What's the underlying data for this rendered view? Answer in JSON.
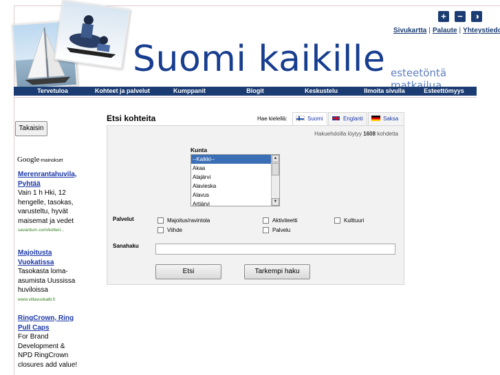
{
  "header": {
    "title": "Suomi kaikille",
    "tagline": "esteetöntä matkailua",
    "icon_buttons": [
      {
        "icon": "plus-icon",
        "glyph": "+"
      },
      {
        "icon": "minus-icon",
        "glyph": "−"
      },
      {
        "icon": "contrast-icon",
        "glyph": "◑"
      }
    ],
    "top_links": [
      "Sivukartta",
      "Palaute",
      "Yhteystiedot"
    ]
  },
  "nav": {
    "items": [
      "Tervetuloa",
      "Kohteet ja palvelut",
      "Kumppanit",
      "Blogit",
      "Keskustelu",
      "Ilmoita sivulla",
      "Esteettömyys"
    ]
  },
  "sidebar": {
    "back_label": "Takaisin",
    "ads_brand": "Google",
    "ads_label": "-mainokset",
    "ads": [
      {
        "title": "Merenrantahuvila, Pyhtää",
        "body": "Vain 1 h Hki, 12 hengelle, tasokas, varusteltu, hyvät maisemat ja vedet",
        "url": "savanturn.com/kotteri..."
      },
      {
        "title": "Majoitusta Vuokatissa",
        "body": "Tasokasta loma-asumista Uussissa huviloissa",
        "url": "www.villavuokatti.fi"
      },
      {
        "title": "RingCrown, Ring Pull Caps",
        "body": "For Brand Development & NPD RingCrown closures add value!",
        "url": ""
      }
    ]
  },
  "main": {
    "title": "Etsi kohteita",
    "language_label": "Hae kielellä:",
    "languages": [
      {
        "label": "Suomi",
        "flag": "finland-flag-icon",
        "active": true
      },
      {
        "label": "Englanti",
        "flag": "uk-flag-icon",
        "active": false
      },
      {
        "label": "Saksa",
        "flag": "germany-flag-icon",
        "active": false
      }
    ],
    "results_prefix": "Hakuehdoilla löytyy",
    "results_count": "1608",
    "results_suffix": "kohdetta",
    "kunta_label": "Kunta",
    "kunta_options": [
      "--Kaikki--",
      "Akaa",
      "Alajärvi",
      "Alavieska",
      "Alavus",
      "Artjärvi"
    ],
    "kunta_selected": "--Kaikki--",
    "palvelut_label": "Palvelut",
    "palvelut_options": [
      "Majoitus/ravintola",
      "Aktiviteetti",
      "Kulttuuri",
      "Viihde",
      "Palvelu"
    ],
    "sanahaku_label": "Sanahaku",
    "sanahaku_value": "",
    "search_button": "Etsi",
    "advanced_button": "Tarkempi haku"
  },
  "colors": {
    "brand_navy": "#1b3c72",
    "title_blue": "#173d8f",
    "tagline_blue": "#5e7fbf",
    "link_blue": "#1a37a8",
    "ad_url_green": "#2e7d1b",
    "panel_bg": "#f2f2f2"
  }
}
